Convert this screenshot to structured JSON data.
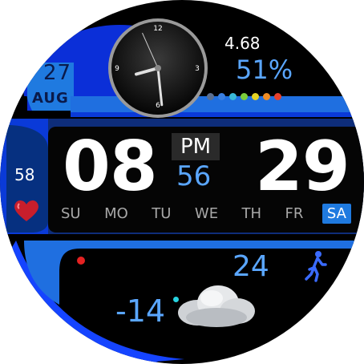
{
  "date": {
    "day": "27",
    "month": "AUG"
  },
  "stats": {
    "top_value": "4.68",
    "battery_percent": "51%"
  },
  "level_dots": [
    "#5b6f90",
    "#3a7fe0",
    "#39b8d6",
    "#7ccd3a",
    "#e5d323",
    "#ef8c23",
    "#e5402b"
  ],
  "time": {
    "hour": "08",
    "minute": "29",
    "ampm": "PM",
    "seconds": "56"
  },
  "heart_rate": "58",
  "weekdays": [
    {
      "label": "SU"
    },
    {
      "label": "MO"
    },
    {
      "label": "TU"
    },
    {
      "label": "WE"
    },
    {
      "label": "TH"
    },
    {
      "label": "FR"
    },
    {
      "label": "SA",
      "active": true
    }
  ],
  "steps": "24",
  "temperature": "-14",
  "analog_clock": {
    "numerals": [
      "12",
      "3",
      "6",
      "9"
    ],
    "hour": 8,
    "minute": 29,
    "second": 56
  },
  "icons": {
    "heart": "heart-icon",
    "walker": "walking-person-icon",
    "cloud": "cloud-icon"
  },
  "colors": {
    "accent": "#1f7ae0",
    "highlight": "#5aa6ff",
    "band": "#0a3ad8"
  }
}
